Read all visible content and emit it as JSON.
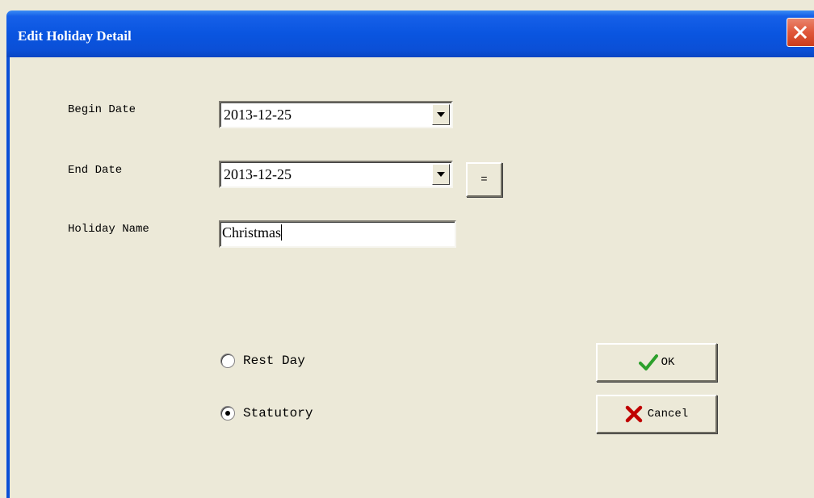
{
  "window": {
    "title": "Edit Holiday Detail"
  },
  "form": {
    "begin_date_label": "Begin Date",
    "begin_date_value": "2013-12-25",
    "end_date_label": "End Date",
    "end_date_value": "2013-12-25",
    "equal_button_label": "=",
    "holiday_name_label": "Holiday Name",
    "holiday_name_value": "Christmas"
  },
  "type": {
    "options": [
      {
        "label": "Rest Day",
        "selected": false
      },
      {
        "label": "Statutory",
        "selected": true
      }
    ]
  },
  "actions": {
    "ok_label": "OK",
    "cancel_label": "Cancel"
  },
  "icons": {
    "ok": "checkmark-icon",
    "cancel": "x-cross-icon",
    "close": "close-icon",
    "dropdown": "chevron-down-icon"
  },
  "colors": {
    "titlebar": "#0a55e0",
    "background": "#ece9d8",
    "ok_check": "#2ca02c",
    "cancel_x": "#c00000",
    "close_btn": "#e0573a"
  }
}
